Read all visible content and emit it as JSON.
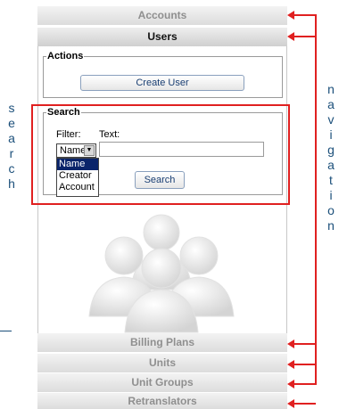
{
  "nav": {
    "accounts": "Accounts",
    "users": "Users",
    "billing_plans": "Billing Plans",
    "units": "Units",
    "unit_groups": "Unit Groups",
    "retranslators": "Retranslators"
  },
  "actions": {
    "legend": "Actions",
    "create_user": "Create User"
  },
  "search": {
    "legend": "Search",
    "filter_label": "Filter:",
    "text_label": "Text:",
    "filter_selected": "Name",
    "filter_options": [
      "Name",
      "Creator",
      "Account"
    ],
    "text_value": "",
    "search_button": "Search"
  },
  "annotations": {
    "left_word": [
      "s",
      "e",
      "a",
      "r",
      "c",
      "h"
    ],
    "right_word": [
      "n",
      "a",
      "v",
      "i",
      "g",
      "a",
      "t",
      "i",
      "o",
      "n"
    ],
    "highlight_color": "#e02020",
    "text_color": "#1b4f7a"
  }
}
